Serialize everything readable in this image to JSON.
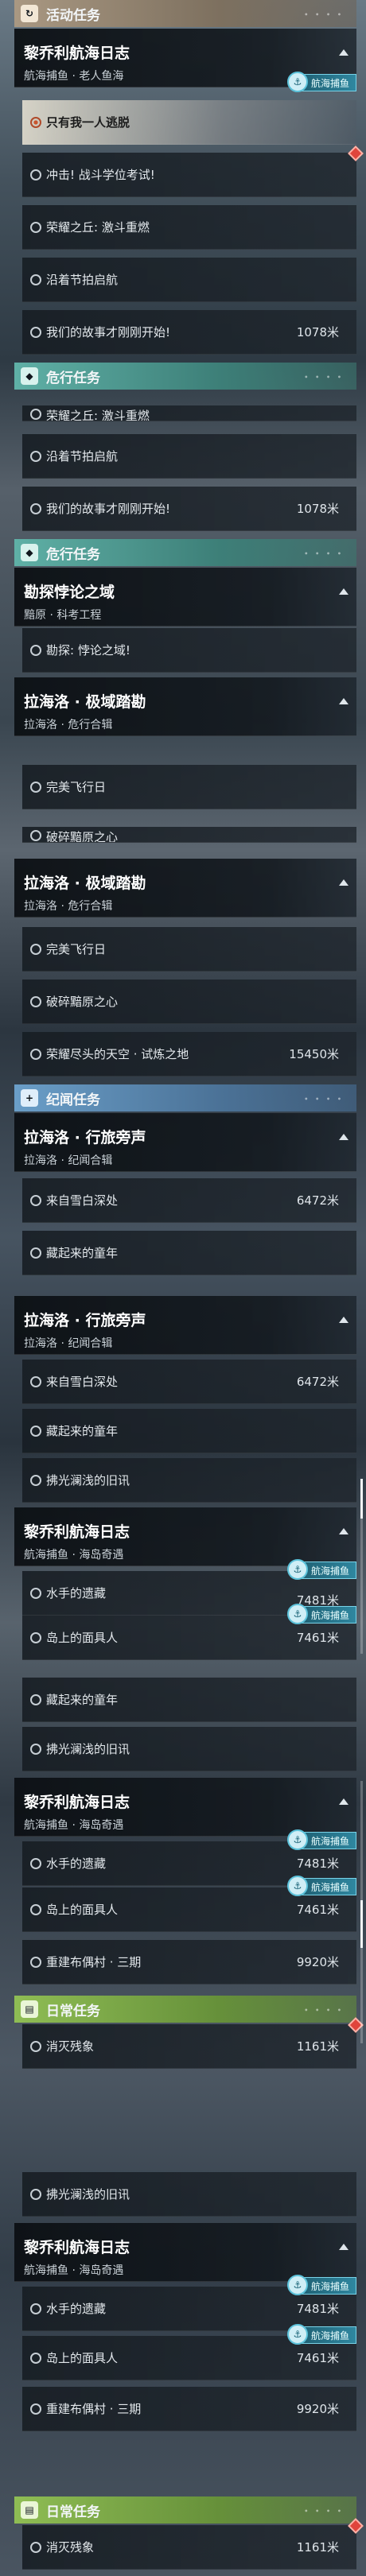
{
  "sections": {
    "activity": "活动任务",
    "danger": "危行任务",
    "lore": "纪闻任务",
    "daily": "日常任务"
  },
  "groups": {
    "joli": {
      "title": "黎乔利航海日志",
      "subtitle_a": "航海捕鱼 · 老人鱼海",
      "subtitle_b": "航海捕鱼 · 海岛奇遇"
    },
    "kankan": {
      "title": "勘探悖论之域",
      "subtitle": "黯原 · 科考工程"
    },
    "lahai_ji": {
      "title": "拉海洛 · 极域踏勘",
      "subtitle": "拉海洛 · 危行合辑"
    },
    "lahai_xing": {
      "title": "拉海洛 · 行旅旁声",
      "subtitle": "拉海洛 · 纪闻合辑"
    }
  },
  "tags": {
    "fishing": "航海捕鱼"
  },
  "quests": {
    "q_flee": "只有我一人逃脱",
    "q_combat": "冲击! 战斗学位考试!",
    "q_glory": "荣耀之丘: 激斗重燃",
    "q_festival": "沿着节拍启航",
    "q_story": "我们的故事才刚刚开始!",
    "q_paradox": "勘探: 悖论之域!",
    "q_flight": "完美飞行日",
    "q_heart": "破碎黯原之心",
    "q_sky": "荣耀尽头的天空 · 试炼之地",
    "q_snow": "来自雪白深处",
    "q_childhood": "藏起来的童年",
    "q_tide": "拂光澜浅的旧讯",
    "q_sailor": "水手的遗藏",
    "q_island": "岛上的面具人",
    "q_idol": "重建布偶村 · 三期",
    "q_vanish": "消灭残象"
  },
  "distances": {
    "d1078": "1078米",
    "d15450": "15450米",
    "d6472": "6472米",
    "d7481": "7481米",
    "d7461": "7461米",
    "d9920": "9920米",
    "d1161": "1161米"
  },
  "icons": {
    "activity": "activity-icon",
    "danger": "danger-icon",
    "lore": "lore-plus-icon",
    "daily": "daily-book-icon",
    "fishing": "fishing-icon",
    "alert": "alert-diamond-icon"
  }
}
